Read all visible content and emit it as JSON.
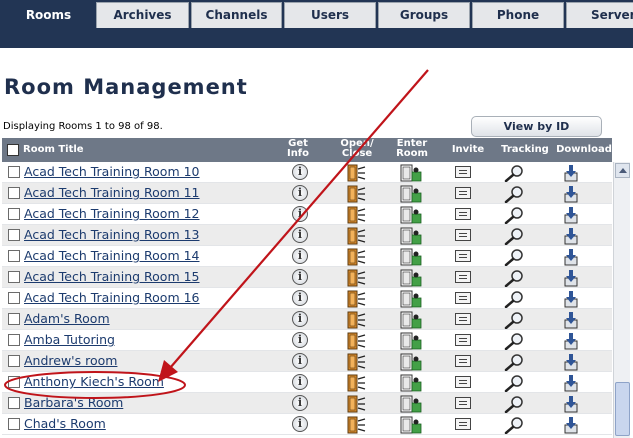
{
  "tabs": [
    "Rooms",
    "Archives",
    "Channels",
    "Users",
    "Groups",
    "Phone",
    "Server"
  ],
  "active_tab": 0,
  "page_title": "Room Management",
  "display_count": "Displaying Rooms 1 to 98 of 98.",
  "view_by_id_label": "View by ID",
  "columns": {
    "room_title": "Room Title",
    "get_info": [
      "Get",
      "Info"
    ],
    "open_close": [
      "Open/",
      "Close"
    ],
    "enter_room": [
      "Enter",
      "Room"
    ],
    "invite": "Invite",
    "tracking": "Tracking",
    "download": "Download"
  },
  "rooms": [
    "Acad Tech Training Room 10",
    "Acad Tech Training Room 11",
    "Acad Tech Training Room 12",
    "Acad Tech Training Room 13",
    "Acad Tech Training Room 14",
    "Acad Tech Training Room 15",
    "Acad Tech Training Room 16",
    "Adam's Room",
    "Amba Tutoring",
    "Andrew's room",
    "Anthony Kiech's Room",
    "Barbara's Room",
    "Chad's Room"
  ],
  "highlighted_room": "Anthony Kiech's Room",
  "colors": {
    "tabbar": "#223554",
    "header_bg": "#6e7887",
    "link": "#1c3b6e",
    "annotation": "#c0141a"
  },
  "icons": {
    "get_info": "info-icon",
    "open_close": "door-icon",
    "enter_room": "enter-room-icon",
    "invite": "invite-icon",
    "tracking": "magnifier-icon",
    "download": "download-icon"
  }
}
